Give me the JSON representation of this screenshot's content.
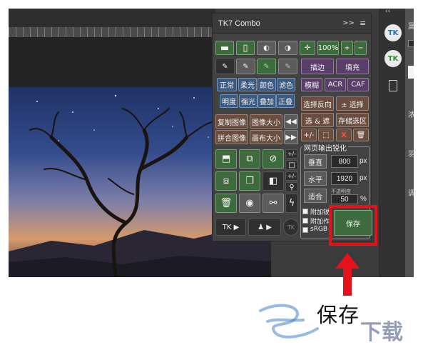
{
  "panel": {
    "title": "TK7 Combo",
    "chevrons": ">>",
    "menu_glyph": "≡",
    "collapse_glyph": "‹‹"
  },
  "row1": {
    "zoom_label": "100%",
    "plus": "+",
    "minus": "−"
  },
  "row2": {
    "stroke_label": "描边",
    "fill_label": "填充"
  },
  "row3": {
    "blur_label": "模糊",
    "acr_label": "ACR",
    "caf_label": "CAF"
  },
  "blend": {
    "modes": [
      "正常",
      "柔光",
      "颜色",
      "滤色",
      "明度",
      "强光",
      "叠加",
      "正叠"
    ]
  },
  "selection": {
    "invert_label": "选择反向",
    "toggle_label": "± 选择"
  },
  "selection2": {
    "select_label": "选 & 遮",
    "store_label": "存储选区"
  },
  "selection3": {
    "plusminus_label": "+/-",
    "x_label": "X"
  },
  "image": {
    "copy_label": "复制图像",
    "image_size_label": "图像大小",
    "flatten_label": "拼合图像",
    "canvas_size_label": "画布大小"
  },
  "sharpen": {
    "title": "网页输出锐化",
    "vertical_label": "垂直",
    "vertical_value": "800",
    "horizontal_label": "水平",
    "horizontal_value": "1920",
    "fit_label": "适合",
    "opacity_label": "不透明度",
    "opacity_value": "50",
    "px_unit": "px",
    "pct_unit": "%",
    "options": [
      "附加锐",
      "附加作",
      "sRGB"
    ],
    "save_label": "保存"
  },
  "side_toggles": {
    "pm1": "+/-",
    "pm2": "+/-"
  },
  "bottom": {
    "tk_label": "TK ▶",
    "user_label": "▶"
  },
  "ps_right": {
    "properties": "属性",
    "density": "浓",
    "feather": "羽",
    "adjust": "调整"
  },
  "badges": {
    "tk_badge": "TK",
    "tk7_badge": "TK"
  },
  "annotation": {
    "caption": "保存",
    "watermark_text": "下载",
    "accent_color": "#e5121b"
  }
}
